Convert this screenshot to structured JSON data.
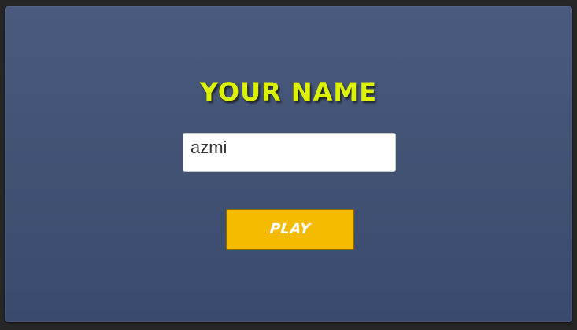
{
  "screen": {
    "title": "YOUR NAME",
    "name_field": {
      "value": "azmi",
      "placeholder": ""
    },
    "play_label": "PLAY"
  },
  "colors": {
    "panel_top": "#4a5a7d",
    "panel_bottom": "#394a6c",
    "title": "#dcf200",
    "button": "#f5bb00",
    "button_text": "#ffffff"
  }
}
